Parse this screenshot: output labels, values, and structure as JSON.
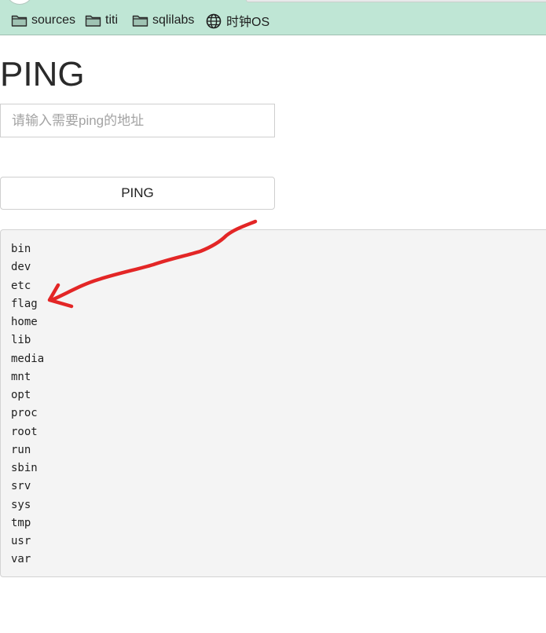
{
  "bookmarks": [
    {
      "label": "sources",
      "icon": "folder-icon"
    },
    {
      "label": "titi",
      "icon": "folder-icon"
    },
    {
      "label": "sqlilabs",
      "icon": "folder-icon"
    },
    {
      "label": "时钟OS",
      "icon": "globe-icon"
    }
  ],
  "page": {
    "title": "PING",
    "input_placeholder": "请输入需要ping的地址",
    "input_value": "",
    "button_label": "PING"
  },
  "output_lines": [
    "bin",
    "dev",
    "etc",
    "flag",
    "home",
    "lib",
    "media",
    "mnt",
    "opt",
    "proc",
    "root",
    "run",
    "sbin",
    "srv",
    "sys",
    "tmp",
    "usr",
    "var"
  ],
  "annotation": {
    "color": "#e32626",
    "points_to": "flag"
  }
}
